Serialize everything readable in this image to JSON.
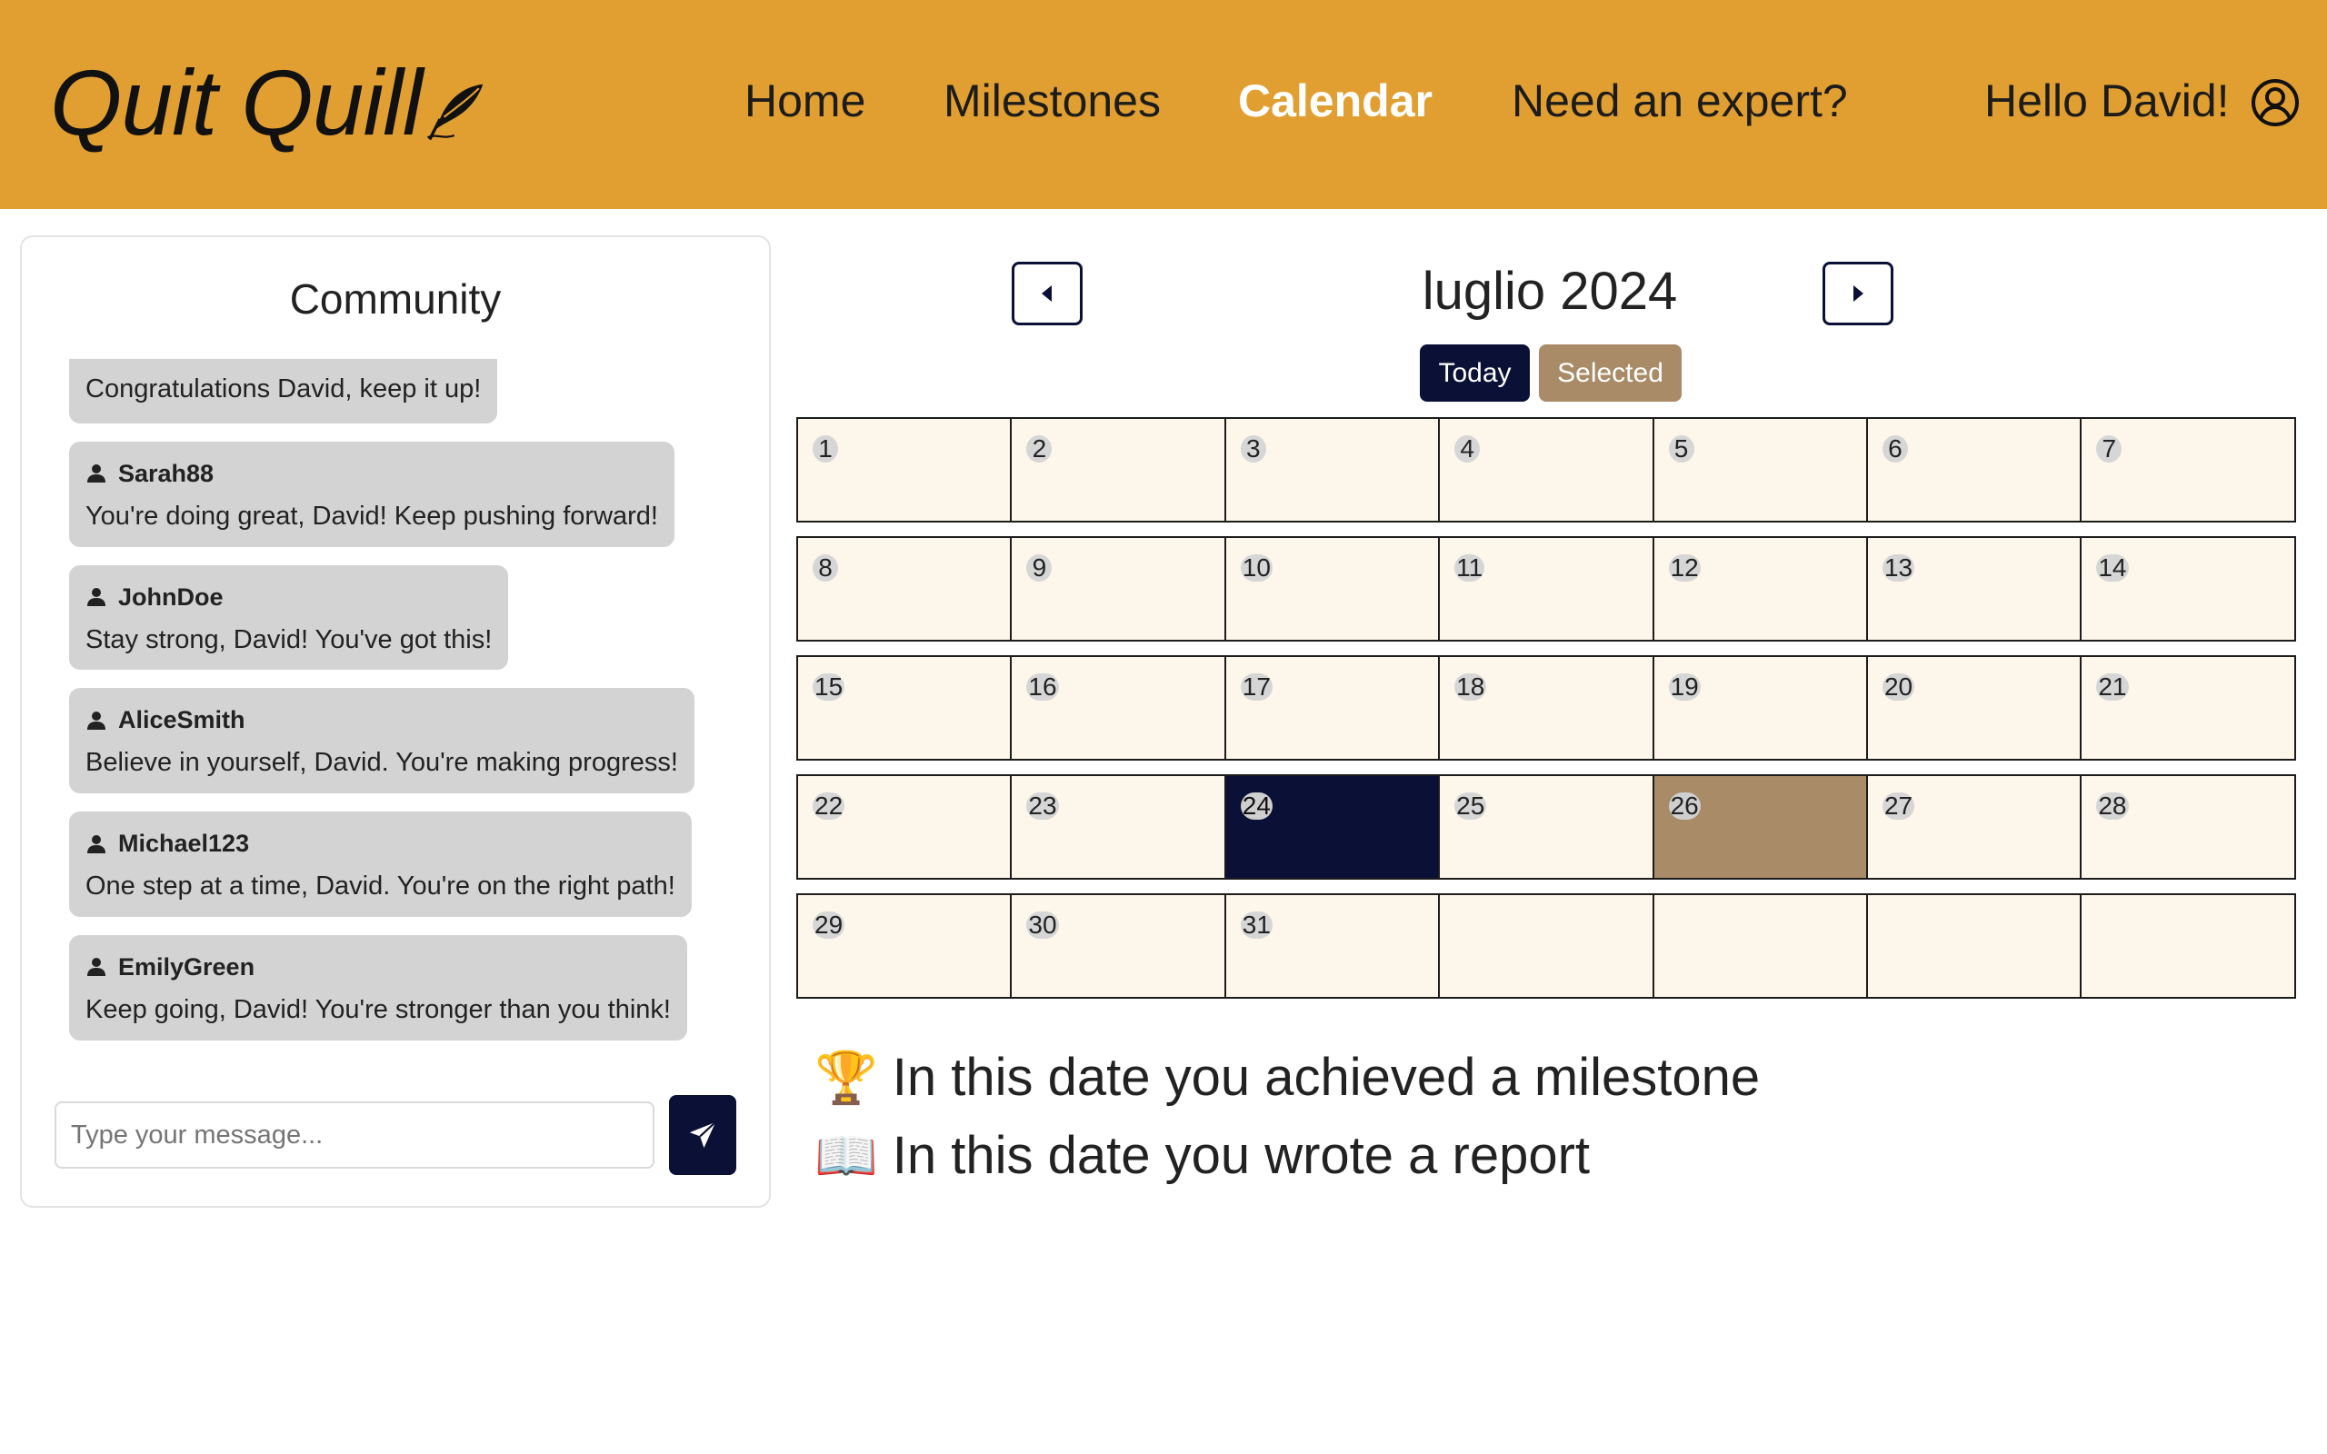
{
  "header": {
    "logo_text": "Quit Quill",
    "nav": [
      {
        "label": "Home",
        "active": false
      },
      {
        "label": "Milestones",
        "active": false
      },
      {
        "label": "Calendar",
        "active": true
      },
      {
        "label": "Need an expert?",
        "active": false
      }
    ],
    "greeting": "Hello David!",
    "colors": {
      "background": "#e29f31",
      "active_text": "#ffffff"
    }
  },
  "community": {
    "title": "Community",
    "messages": [
      {
        "user": "",
        "text": "Congratulations David, keep it up!"
      },
      {
        "user": "Sarah88",
        "text": "You're doing great, David! Keep pushing forward!"
      },
      {
        "user": "JohnDoe",
        "text": "Stay strong, David! You've got this!"
      },
      {
        "user": "AliceSmith",
        "text": "Believe in yourself, David. You're making progress!"
      },
      {
        "user": "Michael123",
        "text": "One step at a time, David. You're on the right path!"
      },
      {
        "user": "EmilyGreen",
        "text": "Keep going, David! You're stronger than you think!"
      }
    ],
    "input_placeholder": "Type your message...",
    "input_value": ""
  },
  "calendar": {
    "month_title": "luglio 2024",
    "today_label": "Today",
    "selected_label": "Selected",
    "today_day": 24,
    "selected_day": 26,
    "colors": {
      "today": "#0b1036",
      "selected": "#a98b67",
      "cell": "#fdf6ea"
    },
    "weeks": [
      [
        "1",
        "2",
        "3",
        "4",
        "5",
        "6",
        "7"
      ],
      [
        "8",
        "9",
        "10",
        "11",
        "12",
        "13",
        "14"
      ],
      [
        "15",
        "16",
        "17",
        "18",
        "19",
        "20",
        "21"
      ],
      [
        "22",
        "23",
        "24",
        "25",
        "26",
        "27",
        "28"
      ],
      [
        "29",
        "30",
        "31",
        "",
        "",
        "",
        ""
      ]
    ]
  },
  "legend": {
    "milestone_icon": "trophy-icon",
    "milestone_text": "In this date you achieved a milestone",
    "report_icon": "open-book-icon",
    "report_text": "In this date you wrote a report"
  }
}
